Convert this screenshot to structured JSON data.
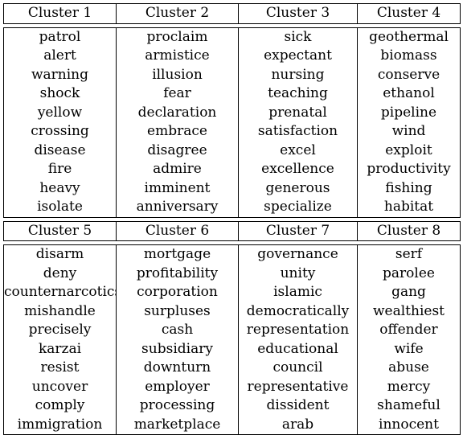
{
  "tables": [
    {
      "headers": [
        "Cluster 1",
        "Cluster 2",
        "Cluster 3",
        "Cluster 4"
      ],
      "rows": [
        [
          "patrol",
          "proclaim",
          "sick",
          "geothermal"
        ],
        [
          "alert",
          "armistice",
          "expectant",
          "biomass"
        ],
        [
          "warning",
          "illusion",
          "nursing",
          "conserve"
        ],
        [
          "shock",
          "fear",
          "teaching",
          "ethanol"
        ],
        [
          "yellow",
          "declaration",
          "prenatal",
          "pipeline"
        ],
        [
          "crossing",
          "embrace",
          "satisfaction",
          "wind"
        ],
        [
          "disease",
          "disagree",
          "excel",
          "exploit"
        ],
        [
          "fire",
          "admire",
          "excellence",
          "productivity"
        ],
        [
          "heavy",
          "imminent",
          "generous",
          "fishing"
        ],
        [
          "isolate",
          "anniversary",
          "specialize",
          "habitat"
        ]
      ]
    },
    {
      "headers": [
        "Cluster 5",
        "Cluster 6",
        "Cluster 7",
        "Cluster 8"
      ],
      "rows": [
        [
          "disarm",
          "mortgage",
          "governance",
          "serf"
        ],
        [
          "deny",
          "profitability",
          "unity",
          "parolee"
        ],
        [
          "counternarcotics",
          "corporation",
          "islamic",
          "gang"
        ],
        [
          "mishandle",
          "surpluses",
          "democratically",
          "wealthiest"
        ],
        [
          "precisely",
          "cash",
          "representation",
          "offender"
        ],
        [
          "karzai",
          "subsidiary",
          "educational",
          "wife"
        ],
        [
          "resist",
          "downturn",
          "council",
          "abuse"
        ],
        [
          "uncover",
          "employer",
          "representative",
          "mercy"
        ],
        [
          "comply",
          "processing",
          "dissident",
          "shameful"
        ],
        [
          "immigration",
          "marketplace",
          "arab",
          "innocent"
        ]
      ]
    }
  ]
}
